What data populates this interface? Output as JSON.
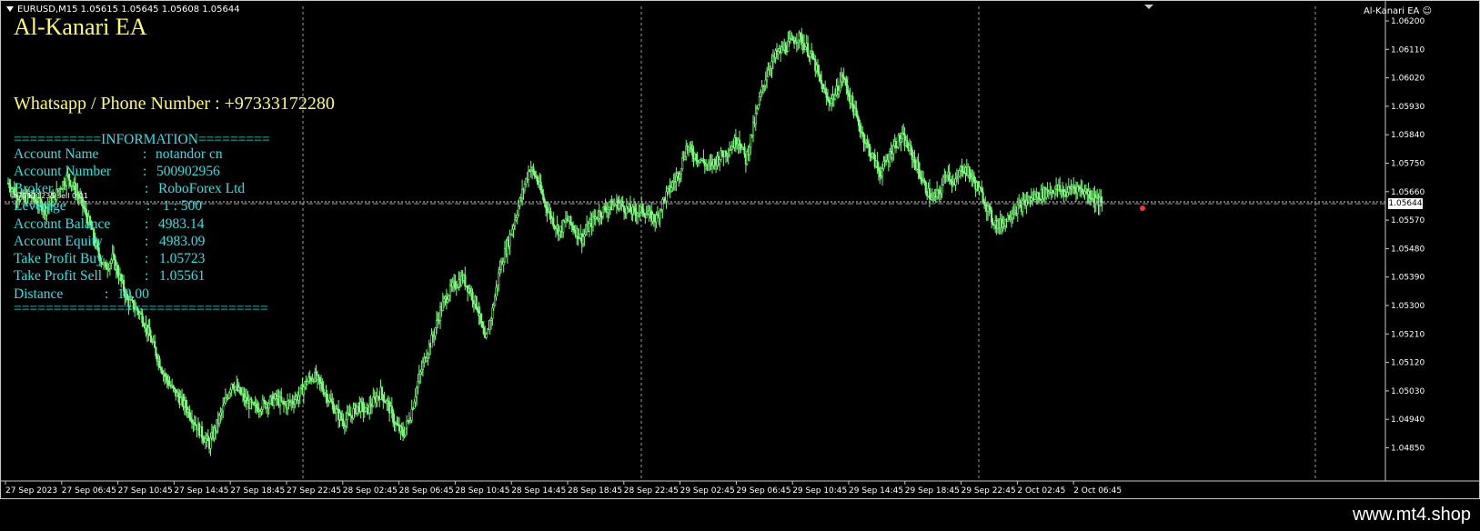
{
  "chart_header": {
    "symbol_info": "EURUSD,M15  1.05615 1.05645 1.05608 1.05644"
  },
  "ea_badge": "Al-Kanari EA ☺",
  "ea_title": "Al-Kanari EA",
  "contact": "Whatsapp / Phone Number : +97333172280",
  "info_panel": {
    "top_border": "===========INFORMATION=========",
    "bottom_border": "================================",
    "rows": [
      {
        "label": "Account Name",
        "sep": ":",
        "value": "notandor cn"
      },
      {
        "label": "Account Number",
        "sep": ":",
        "value": "500902956"
      },
      {
        "label": "Broker",
        "sep": ":",
        "value": "RoboForex Ltd"
      },
      {
        "label": "Leverage",
        "sep": ":",
        "value": "1 : 500"
      },
      {
        "label": "Account Balance",
        "sep": ":",
        "value": "4983.14"
      },
      {
        "label": "Account Equity",
        "sep": ":",
        "value": "4983.09"
      },
      {
        "label": "Take Profit Buy",
        "sep": ":",
        "value": "1.05723"
      },
      {
        "label": "Take Profit Sell",
        "sep": ":",
        "value": "1.05561"
      },
      {
        "label": "Distance",
        "sep": ":",
        "value": "10.00"
      }
    ]
  },
  "order_line_label": "#72121235 sell 0.01",
  "current_price": "1.05644",
  "colors": {
    "candle": "#7cfc7c",
    "title": "#ffff66",
    "info": "#33e0e0",
    "grid": "#9a9a9a"
  },
  "chart_data": {
    "type": "line",
    "title": "EURUSD,M15",
    "y_ticks": [
      "1.06200",
      "1.06110",
      "1.06020",
      "1.05930",
      "1.05840",
      "1.05750",
      "1.05660",
      "1.05570",
      "1.05480",
      "1.05390",
      "1.05300",
      "1.05210",
      "1.05120",
      "1.05030",
      "1.04940",
      "1.04850"
    ],
    "ylim": [
      1.0482,
      1.0624
    ],
    "x_ticks": [
      "27 Sep 2023",
      "27 Sep 06:45",
      "27 Sep 10:45",
      "27 Sep 14:45",
      "27 Sep 18:45",
      "27 Sep 22:45",
      "28 Sep 02:45",
      "28 Sep 06:45",
      "28 Sep 10:45",
      "28 Sep 14:45",
      "28 Sep 18:45",
      "28 Sep 22:45",
      "29 Sep 02:45",
      "29 Sep 06:45",
      "29 Sep 10:45",
      "29 Sep 14:45",
      "29 Sep 18:45",
      "29 Sep 22:45",
      "2 Oct 02:45",
      "2 Oct 06:45"
    ],
    "series": [
      {
        "values": [
          1.0571,
          1.0568,
          1.0566,
          1.0567,
          1.0565,
          1.0563,
          1.0566,
          1.057,
          1.0573,
          1.0569,
          1.0564,
          1.0558,
          1.055,
          1.0545,
          1.0548,
          1.0542,
          1.0535,
          1.0533,
          1.053,
          1.0524,
          1.0518,
          1.0512,
          1.0508,
          1.0505,
          1.0502,
          1.0498,
          1.0494,
          1.0491,
          1.0497,
          1.0503,
          1.051,
          1.0507,
          1.0504,
          1.0502,
          1.0503,
          1.0504,
          1.0505,
          1.0503,
          1.0504,
          1.0506,
          1.051,
          1.0512,
          1.0509,
          1.0505,
          1.0501,
          1.0498,
          1.05,
          1.0503,
          1.0501,
          1.0504,
          1.0507,
          1.0503,
          1.0497,
          1.0494,
          1.05,
          1.051,
          1.0518,
          1.0524,
          1.0532,
          1.0537,
          1.054,
          1.0542,
          1.0538,
          1.0533,
          1.0522,
          1.0532,
          1.0545,
          1.0552,
          1.056,
          1.0568,
          1.0576,
          1.0572,
          1.0565,
          1.056,
          1.0556,
          1.056,
          1.0557,
          1.0554,
          1.0558,
          1.0561,
          1.0563,
          1.0564,
          1.0565,
          1.0563,
          1.0562,
          1.0563,
          1.0561,
          1.056,
          1.0566,
          1.057,
          1.0574,
          1.0582,
          1.058,
          1.0578,
          1.0576,
          1.0578,
          1.058,
          1.0582,
          1.0585,
          1.0578,
          1.0588,
          1.0598,
          1.0606,
          1.061,
          1.0612,
          1.0614,
          1.0616,
          1.0613,
          1.0609,
          1.0602,
          1.0596,
          1.0598,
          1.0604,
          1.0597,
          1.059,
          1.0584,
          1.0579,
          1.0574,
          1.0578,
          1.0583,
          1.0585,
          1.0581,
          1.0576,
          1.057,
          1.0566,
          1.0568,
          1.0575,
          1.057,
          1.0576,
          1.0574,
          1.057,
          1.0566,
          1.056,
          1.0558,
          1.056,
          1.0563,
          1.0564,
          1.0566,
          1.0567,
          1.0568,
          1.0569,
          1.0569,
          1.0568,
          1.057,
          1.0569,
          1.0568,
          1.0566,
          1.0564
        ]
      }
    ]
  },
  "footer_url": "www.mt4.shop"
}
